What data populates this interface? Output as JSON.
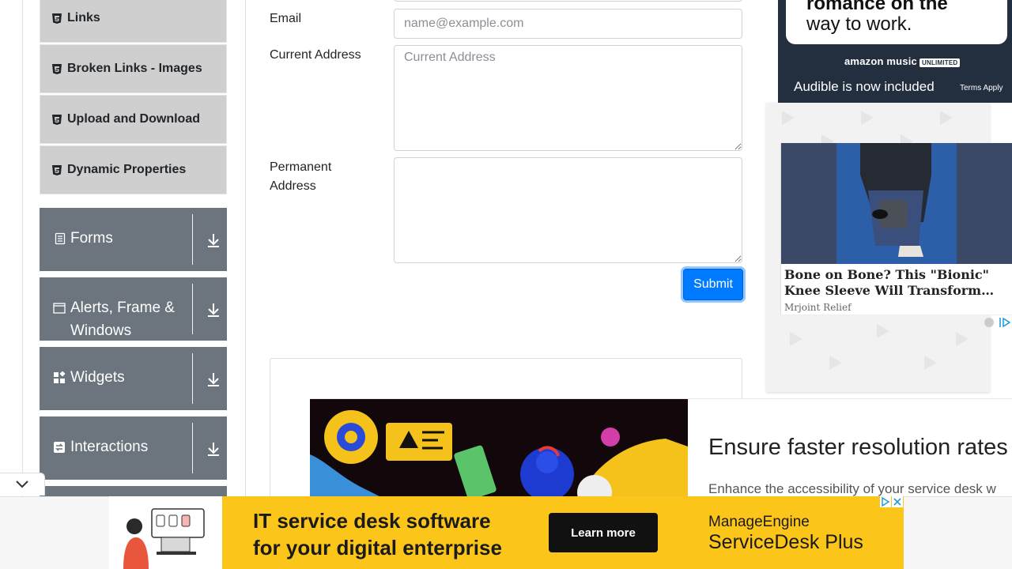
{
  "sidebar": {
    "sub_items": [
      {
        "label": "Links"
      },
      {
        "label": "Broken Links - Images"
      },
      {
        "label": "Upload and Download"
      },
      {
        "label": "Dynamic Properties"
      }
    ],
    "groups": [
      {
        "label": "Forms",
        "icon": "document-icon"
      },
      {
        "label": "Alerts, Frame & Windows",
        "icon": "window-icon"
      },
      {
        "label": "Widgets",
        "icon": "widgets-icon"
      },
      {
        "label": "Interactions",
        "icon": "interactions-icon"
      }
    ]
  },
  "form": {
    "email_label": "Email",
    "email_placeholder": "name@example.com",
    "current_address_label": "Current Address",
    "current_address_placeholder": "Current Address",
    "permanent_address_label": "Permanent Address",
    "submit_label": "Submit"
  },
  "ads": {
    "right_top": {
      "line1": "romance on the",
      "line2": "way to work.",
      "brand": "amazon music",
      "brand_badge": "UNLIMITED",
      "tagline": "Audible is now included",
      "terms": "Terms Apply"
    },
    "right_story": {
      "title_line1": "Bone on Bone? This \"Bionic\"",
      "title_line2": "Knee Sleeve Will Transform…",
      "source": "Mrjoint Relief"
    },
    "mid": {
      "headline": "Ensure faster resolution rates",
      "sub": "Enhance the accessibility of your service desk w"
    },
    "bottom": {
      "line1": "IT service desk software",
      "line2": "for your digital enterprise",
      "cta": "Learn more",
      "brand1": "ManageEngine",
      "brand2": "ServiceDesk Plus"
    }
  },
  "colors": {
    "accent": "#007bff",
    "group_bg": "#6c757d",
    "sub_item_bg": "#cfcfcf",
    "banner_yellow": "#fcc51a"
  }
}
